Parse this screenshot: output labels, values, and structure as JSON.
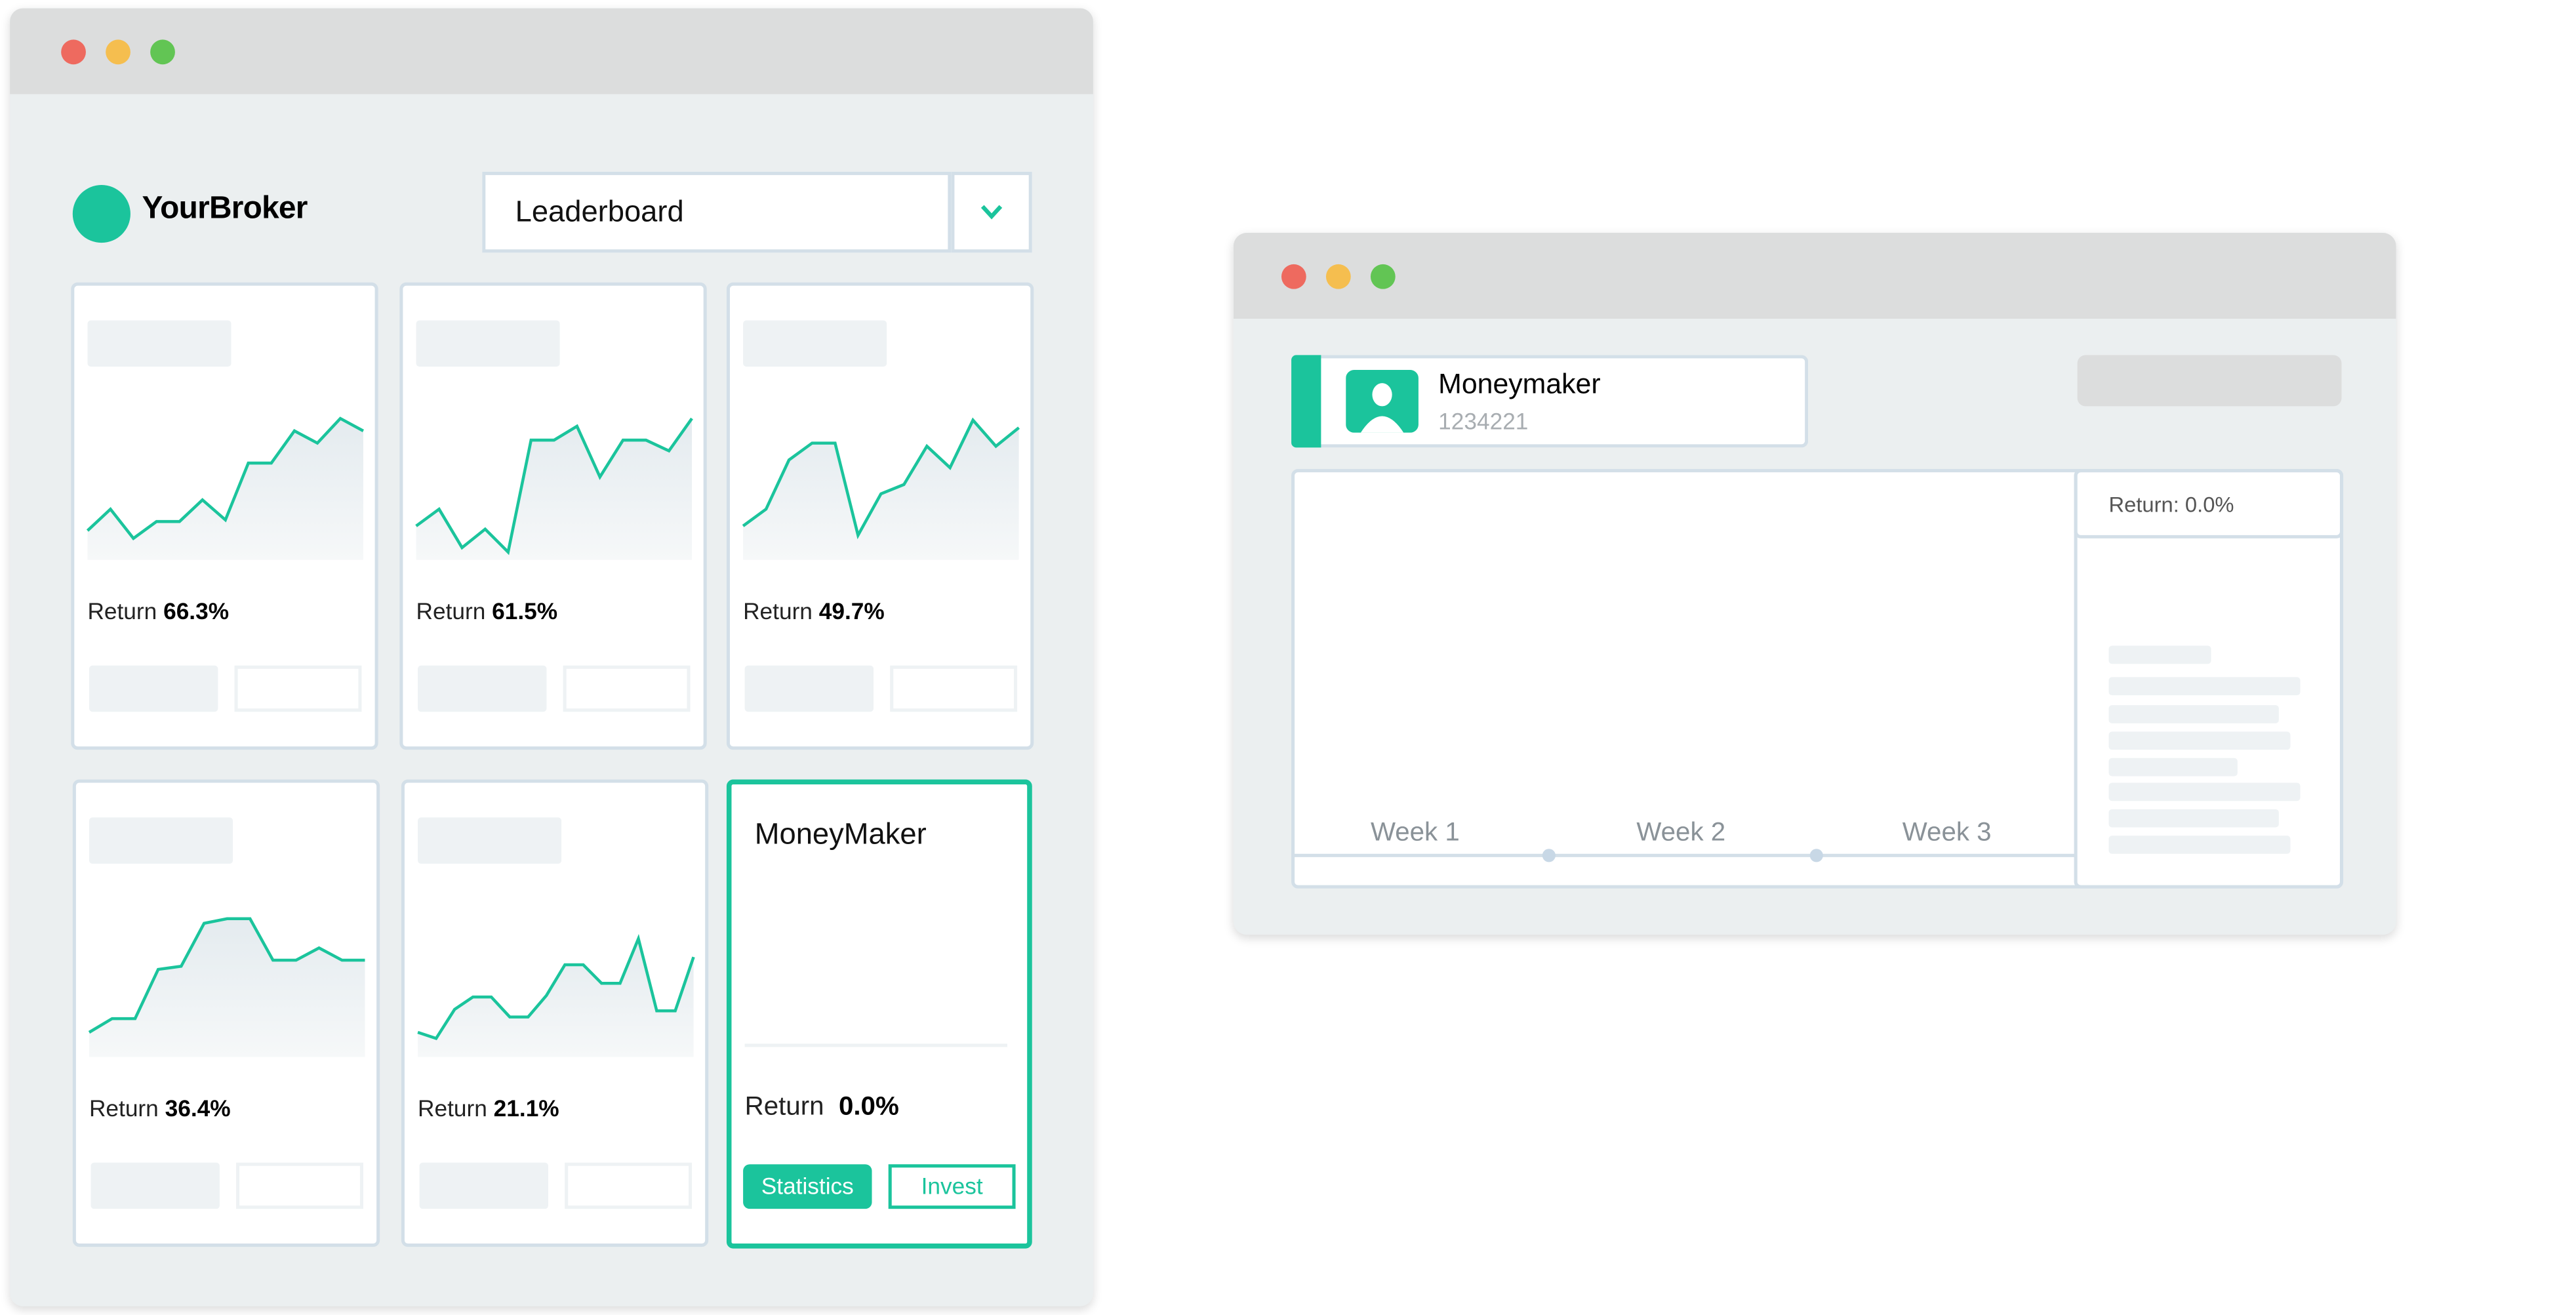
{
  "colors": {
    "accent": "#1bc49c",
    "background": "#ebeff0",
    "titlebar": "#dcdddd",
    "border": "#d3dfe8",
    "traffic": [
      "#ee6a5f",
      "#f5be4f",
      "#62c554"
    ]
  },
  "left_window": {
    "brand": "YourBroker",
    "dropdown": {
      "value": "Leaderboard",
      "icon": "chevron-down-icon"
    },
    "cards": [
      {
        "return_label": "Return",
        "return_value": "66.3%",
        "spark": [
          19,
          33,
          14,
          25,
          25,
          39,
          26,
          63,
          63,
          84,
          76,
          92,
          84
        ]
      },
      {
        "return_label": "Return",
        "return_value": "61.5%",
        "spark": [
          22,
          33,
          8,
          20,
          5,
          78,
          78,
          87,
          54,
          78,
          78,
          71,
          92
        ]
      },
      {
        "return_label": "Return",
        "return_value": "49.7%",
        "spark": [
          22,
          33,
          65,
          76,
          76,
          16,
          43,
          49,
          74,
          60,
          91,
          74,
          86
        ]
      },
      {
        "return_label": "Return",
        "return_value": "36.4%",
        "spark": [
          16,
          25,
          25,
          57,
          59,
          87,
          90,
          90,
          63,
          63,
          71,
          63,
          63
        ]
      },
      {
        "return_label": "Return",
        "return_value": "21.1%",
        "spark": [
          16,
          12,
          31,
          39,
          39,
          26,
          26,
          40,
          60,
          60,
          48,
          48,
          77,
          30,
          30,
          65
        ]
      }
    ],
    "featured": {
      "name": "MoneyMaker",
      "return_label": "Return",
      "return_value": "0.0%",
      "statistics_label": "Statistics",
      "invest_label": "Invest"
    }
  },
  "right_window": {
    "profile": {
      "name": "Moneymaker",
      "id": "1234221",
      "icon": "user-avatar-icon"
    },
    "weeks": [
      "Week 1",
      "Week 2",
      "Week 3"
    ],
    "return_text": "Return: 0.0%"
  }
}
